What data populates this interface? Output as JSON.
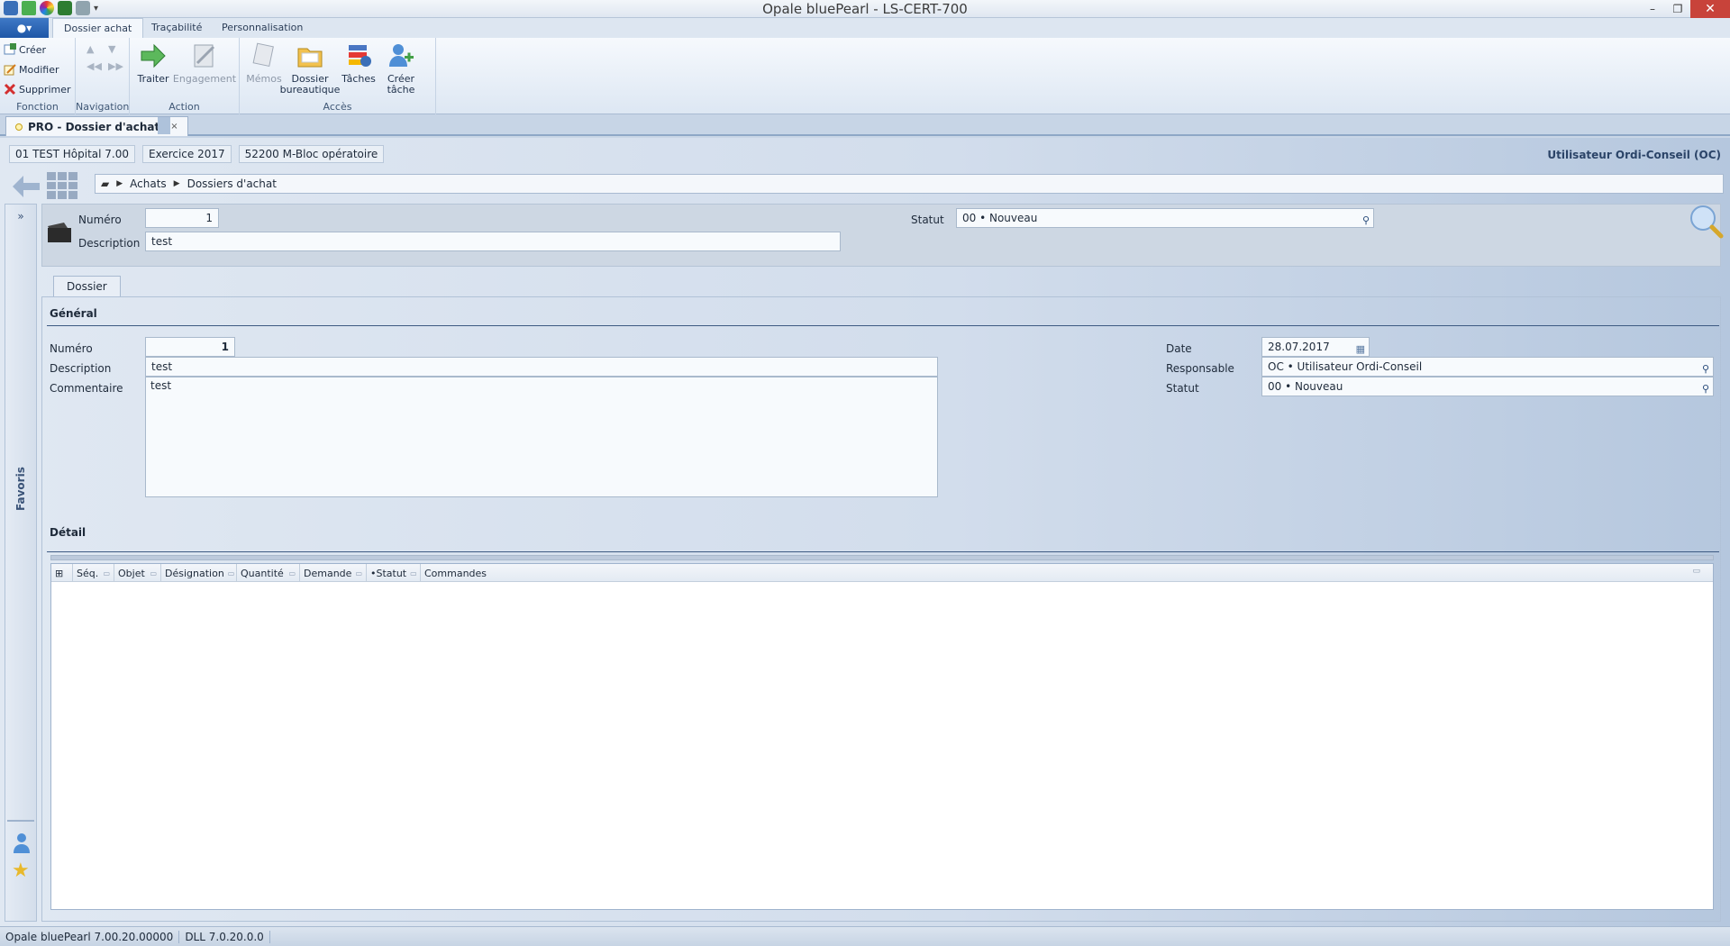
{
  "window": {
    "title": "Opale bluePearl   -   LS-CERT-700",
    "controls": {
      "minimize": "–",
      "restore": "❐",
      "close": "✕"
    }
  },
  "ribbon_tabs": [
    {
      "label": "Dossier achat",
      "active": true
    },
    {
      "label": "Traçabilité",
      "active": false
    },
    {
      "label": "Personnalisation",
      "active": false
    }
  ],
  "ribbon": {
    "fonction": {
      "label": "Fonction",
      "items": [
        {
          "label": "Créer",
          "icon": "create-icon"
        },
        {
          "label": "Modifier",
          "icon": "edit-icon"
        },
        {
          "label": "Supprimer",
          "icon": "delete-icon"
        }
      ]
    },
    "navigation": {
      "label": "Navigation"
    },
    "action": {
      "label": "Action",
      "items": [
        {
          "label": "Traiter",
          "enabled": true
        },
        {
          "label": "Engagement",
          "enabled": false
        }
      ]
    },
    "acces": {
      "label": "Accès",
      "items": [
        {
          "label": "Mémos",
          "enabled": false
        },
        {
          "label": "Dossier bureautique",
          "enabled": true
        },
        {
          "label": "Tâches",
          "enabled": true
        },
        {
          "label": "Créer tâche",
          "enabled": true
        }
      ]
    }
  },
  "document_tab": {
    "label": "PRO - Dossier d'achat",
    "close": "×"
  },
  "context": {
    "establishment": "01 TEST Hôpital 7.00",
    "exercise": "Exercice 2017",
    "service": "52200 M-Bloc opératoire",
    "user": "Utilisateur Ordi-Conseil (OC)"
  },
  "breadcrumb": [
    "Achats",
    "Dossiers d'achat"
  ],
  "favorites": {
    "label": "Favoris",
    "expand": "»"
  },
  "header": {
    "numero_label": "Numéro",
    "numero_value": "1",
    "description_label": "Description",
    "description_value": "test",
    "statut_label": "Statut",
    "statut_value": "00 • Nouveau"
  },
  "tab": {
    "label": "Dossier"
  },
  "general": {
    "title": "Général",
    "numero_label": "Numéro",
    "numero_value": "1",
    "description_label": "Description",
    "description_value": "test",
    "commentaire_label": "Commentaire",
    "commentaire_value": "test",
    "date_label": "Date",
    "date_value": "28.07.2017",
    "responsable_label": "Responsable",
    "responsable_value": "OC • Utilisateur Ordi-Conseil",
    "statut_label": "Statut",
    "statut_value": "00 • Nouveau"
  },
  "detail": {
    "title": "Détail",
    "columns": [
      "Séq.",
      "Objet",
      "Désignation",
      "Quantité",
      "Demande",
      "•Statut",
      "Commandes"
    ],
    "rows": []
  },
  "statusbar": {
    "version": "Opale bluePearl 7.00.20.00000",
    "dll": "DLL 7.0.20.0.0"
  }
}
